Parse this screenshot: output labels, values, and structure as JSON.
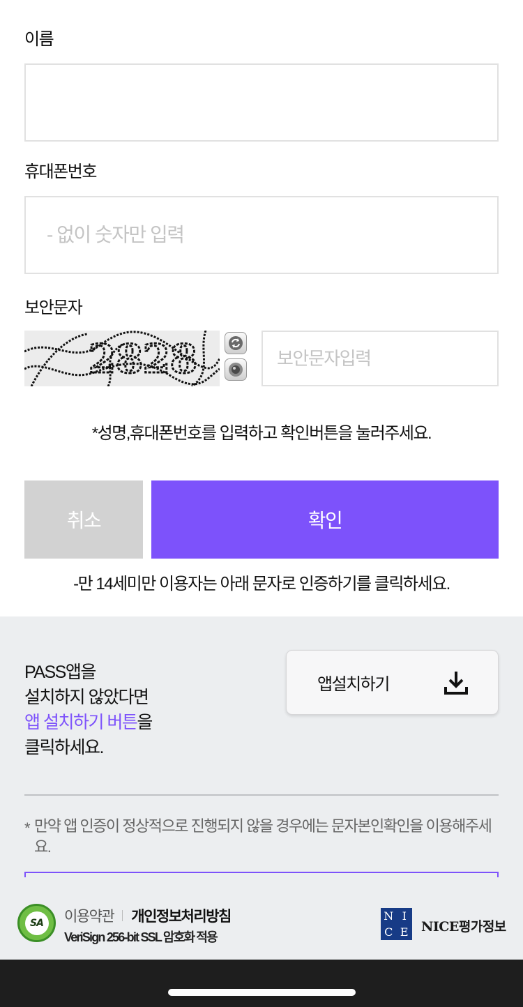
{
  "form": {
    "name_label": "이름",
    "name_value": "",
    "phone_label": "휴대폰번호",
    "phone_placeholder": "- 없이 숫자만 입력",
    "captcha_label": "보안문자",
    "captcha_text": "2828",
    "captcha_placeholder": "보안문자입력",
    "captcha_refresh_icon": "refresh-icon",
    "captcha_audio_icon": "speaker-icon",
    "notice": "*성명,휴대폰번호를 입력하고 확인버튼을 눌러주세요.",
    "cancel_label": "취소",
    "confirm_label": "확인",
    "under14_notice": "-만 14세미만 이용자는 아래 문자로 인증하기를 클릭하세요."
  },
  "pass": {
    "line1": "PASS앱을",
    "line2": "설치하지 않았다면",
    "highlight": "앱 설치하기 버튼",
    "line3_suffix": "을",
    "line4": "클릭하세요.",
    "install_button_label": "앱설치하기",
    "install_icon": "download-icon",
    "footnote_star": "*",
    "footnote": "만약 앱 인증이 정상적으로 진행되지 않을 경우에는 문자본인확인을 이용해주세요."
  },
  "footer": {
    "terms_label": "이용약관",
    "privacy_label": "개인정보처리방침",
    "ssl_text": "VeriSign 256-bit SSL 암호화 적용",
    "seal_text": "SA",
    "nice_letters": [
      "N",
      "I",
      "C",
      "E"
    ],
    "nice_text": "NICE평가정보"
  },
  "colors": {
    "accent": "#7d52fb",
    "cancel_bg": "#d2d2d2",
    "section_bg": "#eceef0",
    "border": "#e1e1e1"
  }
}
